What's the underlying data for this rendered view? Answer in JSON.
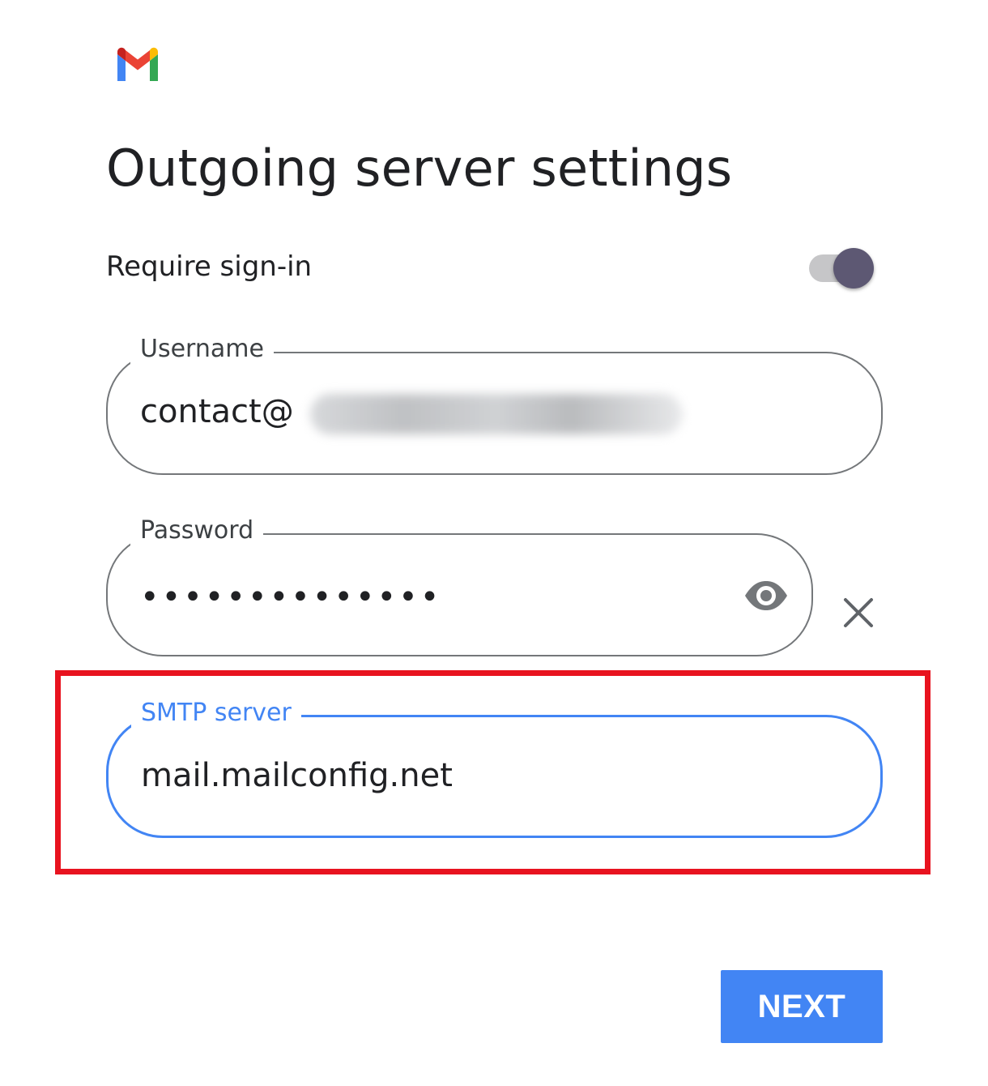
{
  "app": {
    "logo_icon": "gmail-m-logo-icon"
  },
  "header": {
    "title": "Outgoing server settings"
  },
  "require_sign_in": {
    "label": "Require sign-in",
    "enabled": true,
    "track_color": "#c6c6c8",
    "thumb_color": "#5d5873"
  },
  "fields": {
    "username": {
      "label": "Username",
      "value": "contact@"
    },
    "password": {
      "label": "Password",
      "value": "••••••••••••••",
      "reveal_icon": "eye-icon",
      "clear_icon": "close-icon"
    },
    "smtp_server": {
      "label": "SMTP server",
      "value": "mail.mailconfig.net",
      "focused": true
    }
  },
  "actions": {
    "next_label": "NEXT"
  },
  "colors": {
    "accent": "#4285f4",
    "highlight": "#e8131f",
    "outline": "#74777a"
  }
}
